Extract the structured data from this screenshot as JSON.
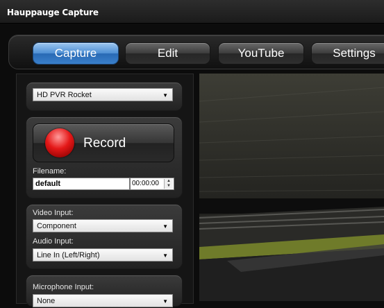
{
  "window": {
    "title": "Hauppauge Capture"
  },
  "tabs": [
    {
      "label": "Capture",
      "active": true
    },
    {
      "label": "Edit",
      "active": false
    },
    {
      "label": "YouTube",
      "active": false
    },
    {
      "label": "Settings",
      "active": false
    }
  ],
  "device": {
    "selected": "HD PVR Rocket"
  },
  "record": {
    "label": "Record"
  },
  "filename": {
    "label": "Filename:",
    "value": "default",
    "duration": "00:00:00"
  },
  "video_input": {
    "label": "Video Input:",
    "selected": "Component"
  },
  "audio_input": {
    "label": "Audio Input:",
    "selected": "Line In (Left/Right)"
  },
  "microphone_input": {
    "label": "Microphone Input:",
    "selected": "None"
  },
  "colors": {
    "accent": "#3a7fca",
    "record": "#e41818",
    "background": "#0c0c0c"
  }
}
